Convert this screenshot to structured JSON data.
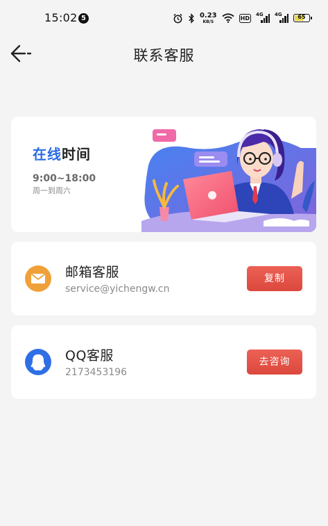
{
  "status_bar": {
    "time": "15:02",
    "notification_badge": "5",
    "network_speed": "0.23",
    "network_speed_unit": "KB/S",
    "hd_label": "HD",
    "signal_1_label": "4G",
    "signal_2_label": "4G",
    "battery_percent": "65",
    "icons": [
      "alarm-icon",
      "bluetooth-icon",
      "wifi-icon",
      "signal-icon",
      "battery-icon"
    ]
  },
  "nav": {
    "title": "联系客服",
    "back_icon": "arrow-left-icon"
  },
  "banner": {
    "heading_highlight": "在线",
    "heading_rest": "时间",
    "hours": "9:00~18:00",
    "days": "周一到周六"
  },
  "email_service": {
    "name": "邮箱客服",
    "detail": "service@yichengw.cn",
    "button_label": "复制",
    "icon": "mail-icon",
    "icon_color": "#f0a038"
  },
  "qq_service": {
    "name": "QQ客服",
    "detail": "2173453196",
    "button_label": "去咨询",
    "icon": "qq-icon",
    "icon_color": "#2f6fe6"
  },
  "colors": {
    "accent_blue": "#2b6be4",
    "button_red": "#e4544a",
    "background": "#f4f4f5"
  }
}
